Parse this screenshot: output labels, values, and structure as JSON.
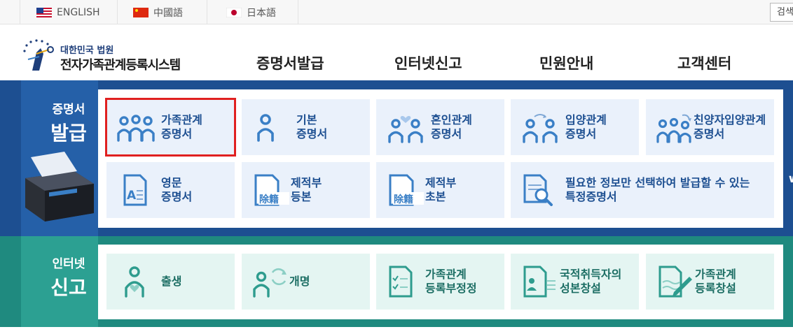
{
  "languages": [
    {
      "label": "ENGLISH",
      "flag": "us-flag-icon"
    },
    {
      "label": "中國語",
      "flag": "cn-flag-icon"
    },
    {
      "label": "日本語",
      "flag": "jp-flag-icon"
    }
  ],
  "search": {
    "label": "검색"
  },
  "logo": {
    "subtitle": "대한민국 법원",
    "title": "전자가족관계등록시스템"
  },
  "nav": [
    "증명서발급",
    "인터넷신고",
    "민원안내",
    "고객센터"
  ],
  "certificates": {
    "title_small": "증명서",
    "title_big": "발급",
    "tiles": [
      {
        "line1": "가족관계",
        "line2": "증명서",
        "icon": "family-icon"
      },
      {
        "line1": "기본",
        "line2": "증명서",
        "icon": "person-icon"
      },
      {
        "line1": "혼인관계",
        "line2": "증명서",
        "icon": "marriage-icon"
      },
      {
        "line1": "입양관계",
        "line2": "증명서",
        "icon": "adoption-icon"
      },
      {
        "line1": "친양자입양관계",
        "line2": "증명서",
        "icon": "full-adoption-icon"
      },
      {
        "line1": "영문",
        "line2": "증명서",
        "icon": "english-document-icon"
      },
      {
        "line1": "제적부",
        "line2": "등본",
        "icon": "register-copy-icon"
      },
      {
        "line1": "제적부",
        "line2": "초본",
        "icon": "register-extract-icon"
      },
      {
        "line1": "필요한 정보만 선택하여 발급할 수 있는",
        "line2": "특정증명서",
        "icon": "document-search-icon"
      }
    ],
    "stamp_text": "除籍"
  },
  "reports": {
    "title_small": "인터넷",
    "title_big": "신고",
    "tiles": [
      {
        "line1": "출생",
        "line2": "",
        "icon": "birth-icon"
      },
      {
        "line1": "개명",
        "line2": "",
        "icon": "rename-icon"
      },
      {
        "line1": "가족관계",
        "line2": "등록부정정",
        "icon": "checklist-document-icon"
      },
      {
        "line1": "국적취득자의",
        "line2": "성본창설",
        "icon": "id-document-icon"
      },
      {
        "line1": "가족관계",
        "line2": "등록창설",
        "icon": "pen-document-icon"
      }
    ]
  },
  "colors": {
    "primary_blue": "#1d4f91",
    "icon_blue": "#3a7fc6",
    "primary_green": "#1f8a7f",
    "icon_green": "#2e9c8e",
    "selection": "#e02020"
  }
}
